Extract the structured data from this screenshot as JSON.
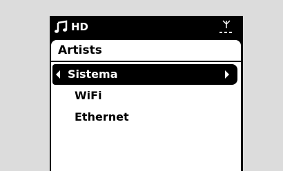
{
  "status_bar": {
    "music_icon": "music-note-icon",
    "hd_label": "HD",
    "signal_icon": "antenna-icon"
  },
  "header": {
    "title": "Artists"
  },
  "menu": {
    "items": [
      {
        "label": "Sistema",
        "selected": true
      },
      {
        "label": "WiFi",
        "selected": false
      },
      {
        "label": "Ethernet",
        "selected": false
      }
    ]
  },
  "colors": {
    "frame": "#dcdcdc",
    "screen_bg": "#000000",
    "content_bg": "#ffffff",
    "text": "#000000",
    "selected_text": "#ffffff"
  }
}
